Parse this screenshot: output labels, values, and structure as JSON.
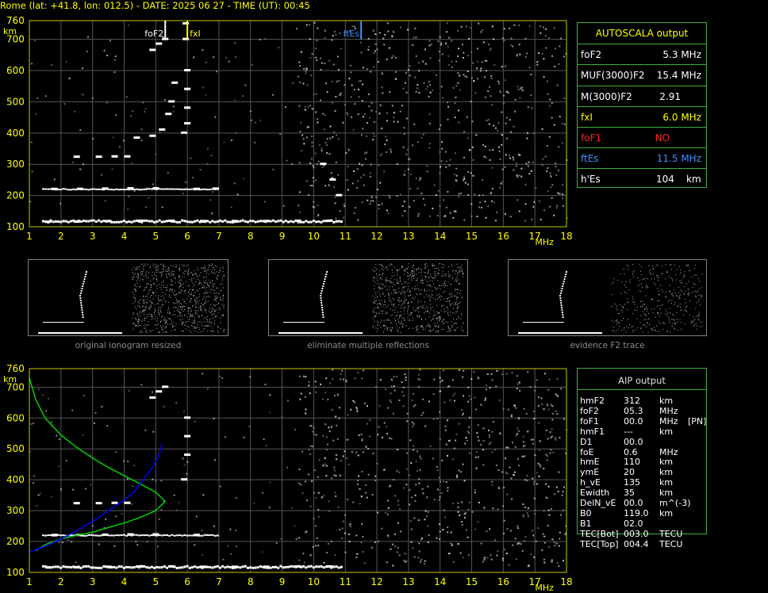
{
  "header": {
    "title": "Rome (lat: +41.8, lon: 012.5) - DATE: 2025 06 27 - TIME (UT): 00:45"
  },
  "axes": {
    "y_unit": "km",
    "x_unit": "MHz",
    "y_ticks": [
      "760",
      "700",
      "600",
      "500",
      "400",
      "300",
      "200",
      "100"
    ],
    "x_ticks": [
      "1",
      "2",
      "3",
      "4",
      "5",
      "6",
      "7",
      "8",
      "9",
      "10",
      "11",
      "12",
      "13",
      "14",
      "15",
      "16",
      "17",
      "18"
    ]
  },
  "markers": [
    {
      "label": "foF2",
      "freq": 5.3,
      "color": "#ffffff"
    },
    {
      "label": "fxI",
      "freq": 6.0,
      "color": "#ffff00"
    },
    {
      "label": "ftEs",
      "freq": 11.5,
      "color": "#3f8fff"
    }
  ],
  "thumbnails": [
    {
      "caption": "original ionogram resized"
    },
    {
      "caption": "eliminate multiple reflections"
    },
    {
      "caption": "evidence F2 trace"
    }
  ],
  "autoscala": {
    "title": "AUTOSCALA output",
    "rows": [
      {
        "label": "foF2",
        "value": "5.3 MHz",
        "label_color": "#ffffff",
        "value_color": "#ffffff"
      },
      {
        "label": "MUF(3000)F2",
        "value": "15.4 MHz",
        "label_color": "#ffffff",
        "value_color": "#ffffff"
      },
      {
        "label": "M(3000)F2",
        "value": "2.91",
        "label_color": "#ffffff",
        "value_color": "#ffffff"
      },
      {
        "label": "fxI",
        "value": "6.0 MHz",
        "label_color": "#ffff00",
        "value_color": "#ffff00"
      },
      {
        "label": "foF1",
        "value": "NO",
        "label_color": "#ff2020",
        "value_color": "#ff2020"
      },
      {
        "label": "ftEs",
        "value": "11.5 MHz",
        "label_color": "#3f8fff",
        "value_color": "#3f8fff"
      },
      {
        "label": "h'Es",
        "value": "104",
        "unit": "km",
        "label_color": "#ffffff",
        "value_color": "#ffffff"
      }
    ]
  },
  "aip": {
    "title": "AIP output",
    "rows": [
      {
        "name": "hmF2",
        "value": "312",
        "unit": "km"
      },
      {
        "name": "foF2",
        "value": "05.3",
        "unit": "MHz"
      },
      {
        "name": "foF1",
        "value": "00.0",
        "unit": "MHz",
        "extra": "[PN]"
      },
      {
        "name": "hmF1",
        "value": "---",
        "unit": "km"
      },
      {
        "name": "D1",
        "value": "00.0",
        "unit": ""
      },
      {
        "name": "foE",
        "value": "0.6",
        "unit": "MHz"
      },
      {
        "name": "hmE",
        "value": "110",
        "unit": "km"
      },
      {
        "name": "ymE",
        "value": "20",
        "unit": "km"
      },
      {
        "name": "h_vE",
        "value": "135",
        "unit": "km"
      },
      {
        "name": "Ewidth",
        "value": "35",
        "unit": "km"
      },
      {
        "name": "DelN_vE",
        "value": "00.0",
        "unit": "m^(-3)"
      },
      {
        "name": "B0",
        "value": "119.0",
        "unit": "km"
      },
      {
        "name": "B1",
        "value": "02.0",
        "unit": ""
      },
      {
        "name": "TEC[Bot]",
        "value": "003.0",
        "unit": "TECU"
      },
      {
        "name": "TEC[Top]",
        "value": "004.4",
        "unit": "TECU"
      }
    ]
  },
  "chart_data": [
    {
      "type": "scatter",
      "title": "",
      "xlabel": "MHz",
      "ylabel": "km",
      "xlim": [
        1,
        18
      ],
      "ylim": [
        100,
        760
      ],
      "grid": true,
      "series": [
        {
          "points": [
            [
              1.6,
              115
            ],
            [
              2.5,
              115
            ],
            [
              3.5,
              117
            ],
            [
              4.5,
              118
            ],
            [
              5.5,
              118
            ],
            [
              6.5,
              117
            ],
            [
              7.5,
              117
            ],
            [
              8.5,
              117
            ],
            [
              9.5,
              118
            ],
            [
              10.5,
              118
            ],
            [
              1.8,
              220
            ],
            [
              2.6,
              220
            ],
            [
              3.4,
              221
            ],
            [
              4.2,
              222
            ],
            [
              5.0,
              222
            ],
            [
              6.3,
              220
            ],
            [
              6.9,
              221
            ],
            [
              2.5,
              323
            ],
            [
              3.2,
              323
            ],
            [
              3.7,
              324
            ],
            [
              4.1,
              324
            ],
            [
              4.4,
              384
            ],
            [
              4.9,
              390
            ],
            [
              5.2,
              410
            ],
            [
              5.4,
              460
            ],
            [
              5.5,
              500
            ],
            [
              5.6,
              560
            ],
            [
              4.9,
              665
            ],
            [
              5.1,
              685
            ],
            [
              5.3,
              700
            ],
            [
              5.9,
              400
            ],
            [
              6.0,
              430
            ],
            [
              6.0,
              480
            ],
            [
              6.0,
              540
            ],
            [
              6.0,
              600
            ],
            [
              5.95,
              700
            ],
            [
              5.95,
              750
            ],
            [
              10.3,
              300
            ],
            [
              10.6,
              250
            ],
            [
              10.8,
              200
            ]
          ]
        }
      ]
    },
    {
      "type": "line",
      "title": "",
      "xlabel": "MHz",
      "ylabel": "km",
      "xlim": [
        1,
        18
      ],
      "ylim": [
        100,
        760
      ],
      "grid": true,
      "series": [
        {
          "color": "#00d000",
          "x": [
            1.0,
            1.2,
            1.5,
            2.0,
            2.5,
            3.0,
            3.5,
            4.0,
            4.5,
            5.0,
            5.3,
            5.0,
            4.5,
            4.0,
            3.5,
            3.0,
            2.5,
            2.0,
            1.5,
            1.2
          ],
          "y": [
            730,
            660,
            600,
            545,
            505,
            470,
            440,
            413,
            387,
            360,
            330,
            300,
            278,
            260,
            245,
            230,
            220,
            208,
            190,
            170
          ]
        },
        {
          "color": "#0000ff",
          "x": [
            1.0,
            1.5,
            2.0,
            2.5,
            3.0,
            3.5,
            4.0,
            4.3,
            4.6,
            4.9,
            5.1,
            5.2
          ],
          "y": [
            165,
            185,
            208,
            235,
            265,
            300,
            335,
            360,
            400,
            440,
            480,
            520
          ]
        },
        {
          "points": [
            [
              1.6,
              115
            ],
            [
              2.5,
              115
            ],
            [
              3.5,
              117
            ],
            [
              4.5,
              118
            ],
            [
              5.5,
              118
            ],
            [
              6.5,
              117
            ],
            [
              7.5,
              117
            ],
            [
              8.5,
              117
            ],
            [
              9.5,
              118
            ],
            [
              10.5,
              118
            ],
            [
              1.8,
              220
            ],
            [
              2.6,
              220
            ],
            [
              3.4,
              221
            ],
            [
              4.2,
              222
            ],
            [
              5.0,
              222
            ],
            [
              6.3,
              220
            ],
            [
              2.5,
              323
            ],
            [
              3.2,
              323
            ],
            [
              3.7,
              324
            ],
            [
              4.1,
              324
            ],
            [
              4.9,
              665
            ],
            [
              5.1,
              685
            ],
            [
              5.3,
              700
            ],
            [
              5.9,
              400
            ],
            [
              6.0,
              480
            ],
            [
              6.0,
              540
            ],
            [
              6.0,
              600
            ]
          ]
        }
      ]
    }
  ]
}
